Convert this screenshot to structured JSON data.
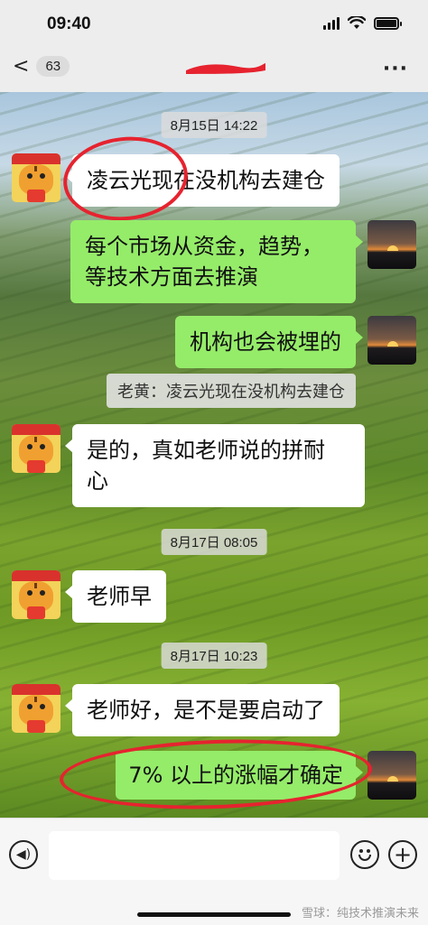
{
  "status_bar": {
    "time": "09:40"
  },
  "nav": {
    "back_chevron": "<",
    "unread_count": "63",
    "more": "···"
  },
  "messages": [
    {
      "type": "time",
      "text": "8月15日 14:22"
    },
    {
      "type": "in",
      "text": "凌云光现在没机构去建仓"
    },
    {
      "type": "out",
      "text": "每个市场从资金，趋势，\n等技术方面去推演"
    },
    {
      "type": "out",
      "text": "机构也会被埋的"
    },
    {
      "type": "quote",
      "text": "老黄：凌云光现在没机构去建仓"
    },
    {
      "type": "in",
      "text": "是的，真如老师说的拼耐\n心"
    },
    {
      "type": "time",
      "text": "8月17日 08:05"
    },
    {
      "type": "in",
      "text": "老师早"
    },
    {
      "type": "time",
      "text": "8月17日 10:23"
    },
    {
      "type": "in",
      "text": "老师好，是不是要启动了"
    },
    {
      "type": "out",
      "text": "7% 以上的涨幅才确定"
    }
  ],
  "input_bar": {
    "voice_glyph": "◀)",
    "plus_glyph": "+"
  },
  "watermark": "雪球：纯技术推演未来",
  "colors": {
    "outgoing_bubble": "#95ec69",
    "incoming_bubble": "#ffffff",
    "annotation": "#e6232f"
  }
}
